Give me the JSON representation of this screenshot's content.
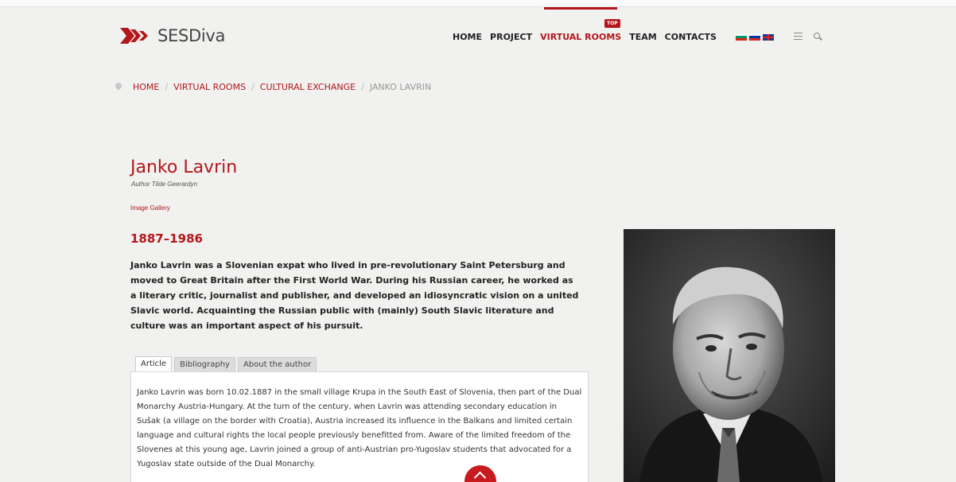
{
  "brand": {
    "name": "SESDiva",
    "logo_icon": "triple-chevron-logo-icon",
    "accent": "#b3161b"
  },
  "nav": {
    "items": [
      {
        "label": "HOME"
      },
      {
        "label": "PROJECT"
      },
      {
        "label": "VIRTUAL ROOMS",
        "active": true,
        "badge": "TOP"
      },
      {
        "label": "TEAM"
      },
      {
        "label": "CONTACTS"
      }
    ],
    "languages": [
      "bulgarian-flag-icon",
      "russian-flag-icon",
      "uk-flag-icon"
    ],
    "menu_icon": "hamburger-menu-icon",
    "search_icon": "search-icon"
  },
  "breadcrumb": {
    "icon": "location-pin-icon",
    "items": [
      "HOME",
      "VIRTUAL ROOMS",
      "CULTURAL EXCHANGE"
    ],
    "current": "JANKO LAVRIN",
    "separator": "/"
  },
  "article": {
    "title": "Janko Lavrin",
    "author": "Author Tilde Geerardyn",
    "gallery_link": "Image Gallery",
    "dates": "1887–1986",
    "lead": "Janko Lavrin was a Slovenian expat who lived in pre-revolutionary Saint Petersburg and moved to Great Britain after the First World War. During his Russian career, he worked as a literary critic, journalist and publisher, and developed an idiosyncratic vision on a united Slavic world. Acquainting the Russian public with (mainly) South Slavic literature and culture was an important aspect of his pursuit.",
    "tabs": [
      {
        "label": "Article",
        "active": true
      },
      {
        "label": "Bibliography"
      },
      {
        "label": "About the author"
      }
    ],
    "body": "Janko Lavrin was born 10.02.1887 in the small village Krupa in the South East of Slovenia, then part of the Dual Monarchy Austria-Hungary. At the turn of the century, when Lavrin was attending secondary education in Sušak (a village on the border with Croatia), Austria increased its influence in the Balkans and limited certain language and cultural rights the local people previously benefitted from. Aware of the limited freedom of the Slovenes at this young age, Lavrin joined a group of anti-Austrian pro-Yugoslav students that advocated for a Yugoslav state outside of the Dual Monarchy."
  },
  "portrait": {
    "alt_icon": "portrait-photo-icon"
  },
  "scroll_top_icon": "chevron-up-icon"
}
